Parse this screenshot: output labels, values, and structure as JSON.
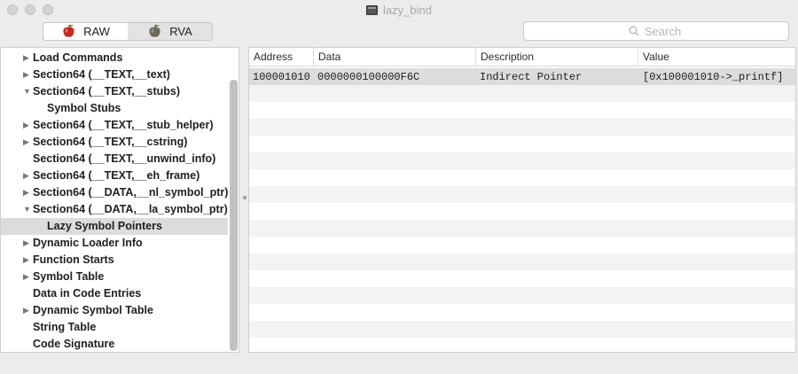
{
  "window": {
    "title": "lazy_bind"
  },
  "toolbar": {
    "modes": [
      {
        "label": "RAW",
        "active": true
      },
      {
        "label": "RVA",
        "active": false
      }
    ],
    "search_placeholder": "Search"
  },
  "tree": [
    {
      "label": "Load Commands",
      "level": 0,
      "disclosure": "collapsed"
    },
    {
      "label": "Section64 (__TEXT,__text)",
      "level": 0,
      "disclosure": "collapsed"
    },
    {
      "label": "Section64 (__TEXT,__stubs)",
      "level": 0,
      "disclosure": "expanded"
    },
    {
      "label": "Symbol Stubs",
      "level": 1,
      "disclosure": "none"
    },
    {
      "label": "Section64 (__TEXT,__stub_helper)",
      "level": 0,
      "disclosure": "collapsed"
    },
    {
      "label": "Section64 (__TEXT,__cstring)",
      "level": 0,
      "disclosure": "collapsed"
    },
    {
      "label": "Section64 (__TEXT,__unwind_info)",
      "level": 0,
      "disclosure": "none"
    },
    {
      "label": "Section64 (__TEXT,__eh_frame)",
      "level": 0,
      "disclosure": "collapsed"
    },
    {
      "label": "Section64 (__DATA,__nl_symbol_ptr)",
      "level": 0,
      "disclosure": "collapsed"
    },
    {
      "label": "Section64 (__DATA,__la_symbol_ptr)",
      "level": 0,
      "disclosure": "expanded"
    },
    {
      "label": "Lazy Symbol Pointers",
      "level": 1,
      "disclosure": "none",
      "selected": true
    },
    {
      "label": "Dynamic Loader Info",
      "level": 0,
      "disclosure": "collapsed"
    },
    {
      "label": "Function Starts",
      "level": 0,
      "disclosure": "collapsed"
    },
    {
      "label": "Symbol Table",
      "level": 0,
      "disclosure": "collapsed"
    },
    {
      "label": "Data in Code Entries",
      "level": 0,
      "disclosure": "none"
    },
    {
      "label": "Dynamic Symbol Table",
      "level": 0,
      "disclosure": "collapsed"
    },
    {
      "label": "String Table",
      "level": 0,
      "disclosure": "none"
    },
    {
      "label": "Code Signature",
      "level": 0,
      "disclosure": "none"
    }
  ],
  "table": {
    "columns": [
      "Address",
      "Data",
      "Description",
      "Value"
    ],
    "rows": [
      [
        "100001010",
        "0000000100000F6C",
        "Indirect Pointer",
        "[0x100001010->_printf]"
      ]
    ],
    "selected_row": 0
  },
  "colors": {
    "selection": "#dcdcdc",
    "stripe": "#f3f3f3"
  }
}
